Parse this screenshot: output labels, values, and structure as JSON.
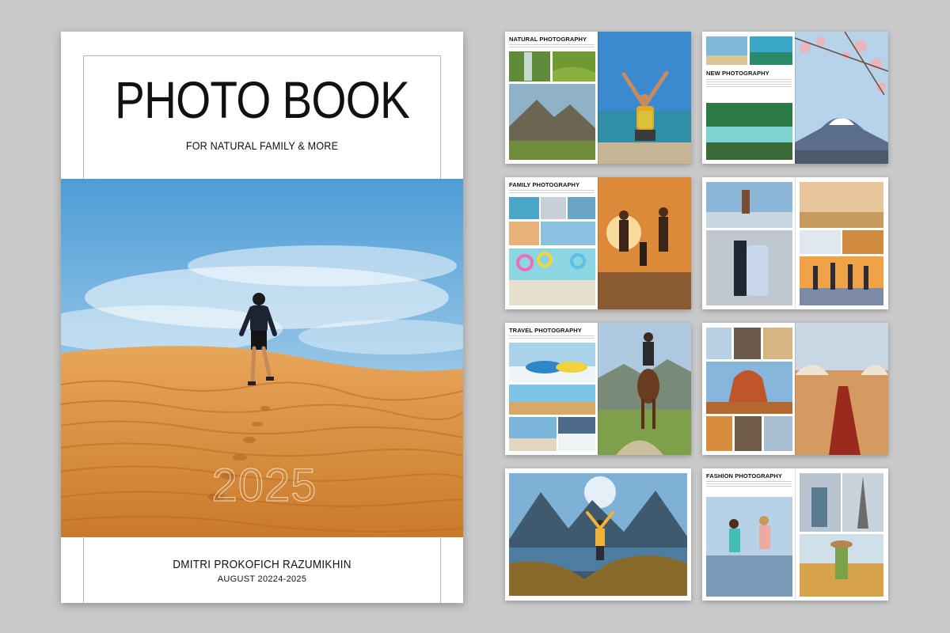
{
  "cover": {
    "title": "PHOTO BOOK",
    "subtitle": "FOR NATURAL FAMILY & MORE",
    "year": "2025",
    "author": "DMITRI PROKOFICH RAZUMIKHIN",
    "date": "AUGUST 20224-2025"
  },
  "spreads": [
    {
      "title": "NATURAL PHOTOGRAPHY"
    },
    {
      "title": "NEW PHOTOGRAPHY"
    },
    {
      "title": "FAMILY PHOTOGRAPHY"
    },
    {
      "title": ""
    },
    {
      "title": "TRAVEL PHOTOGRAPHY"
    },
    {
      "title": ""
    },
    {
      "title": ""
    },
    {
      "title": "FASHION PHOTOGRAPHY"
    }
  ],
  "colors": {
    "background": "#c9c9c9",
    "sky": "#7fb6dc",
    "sand": "#d98f3e"
  }
}
